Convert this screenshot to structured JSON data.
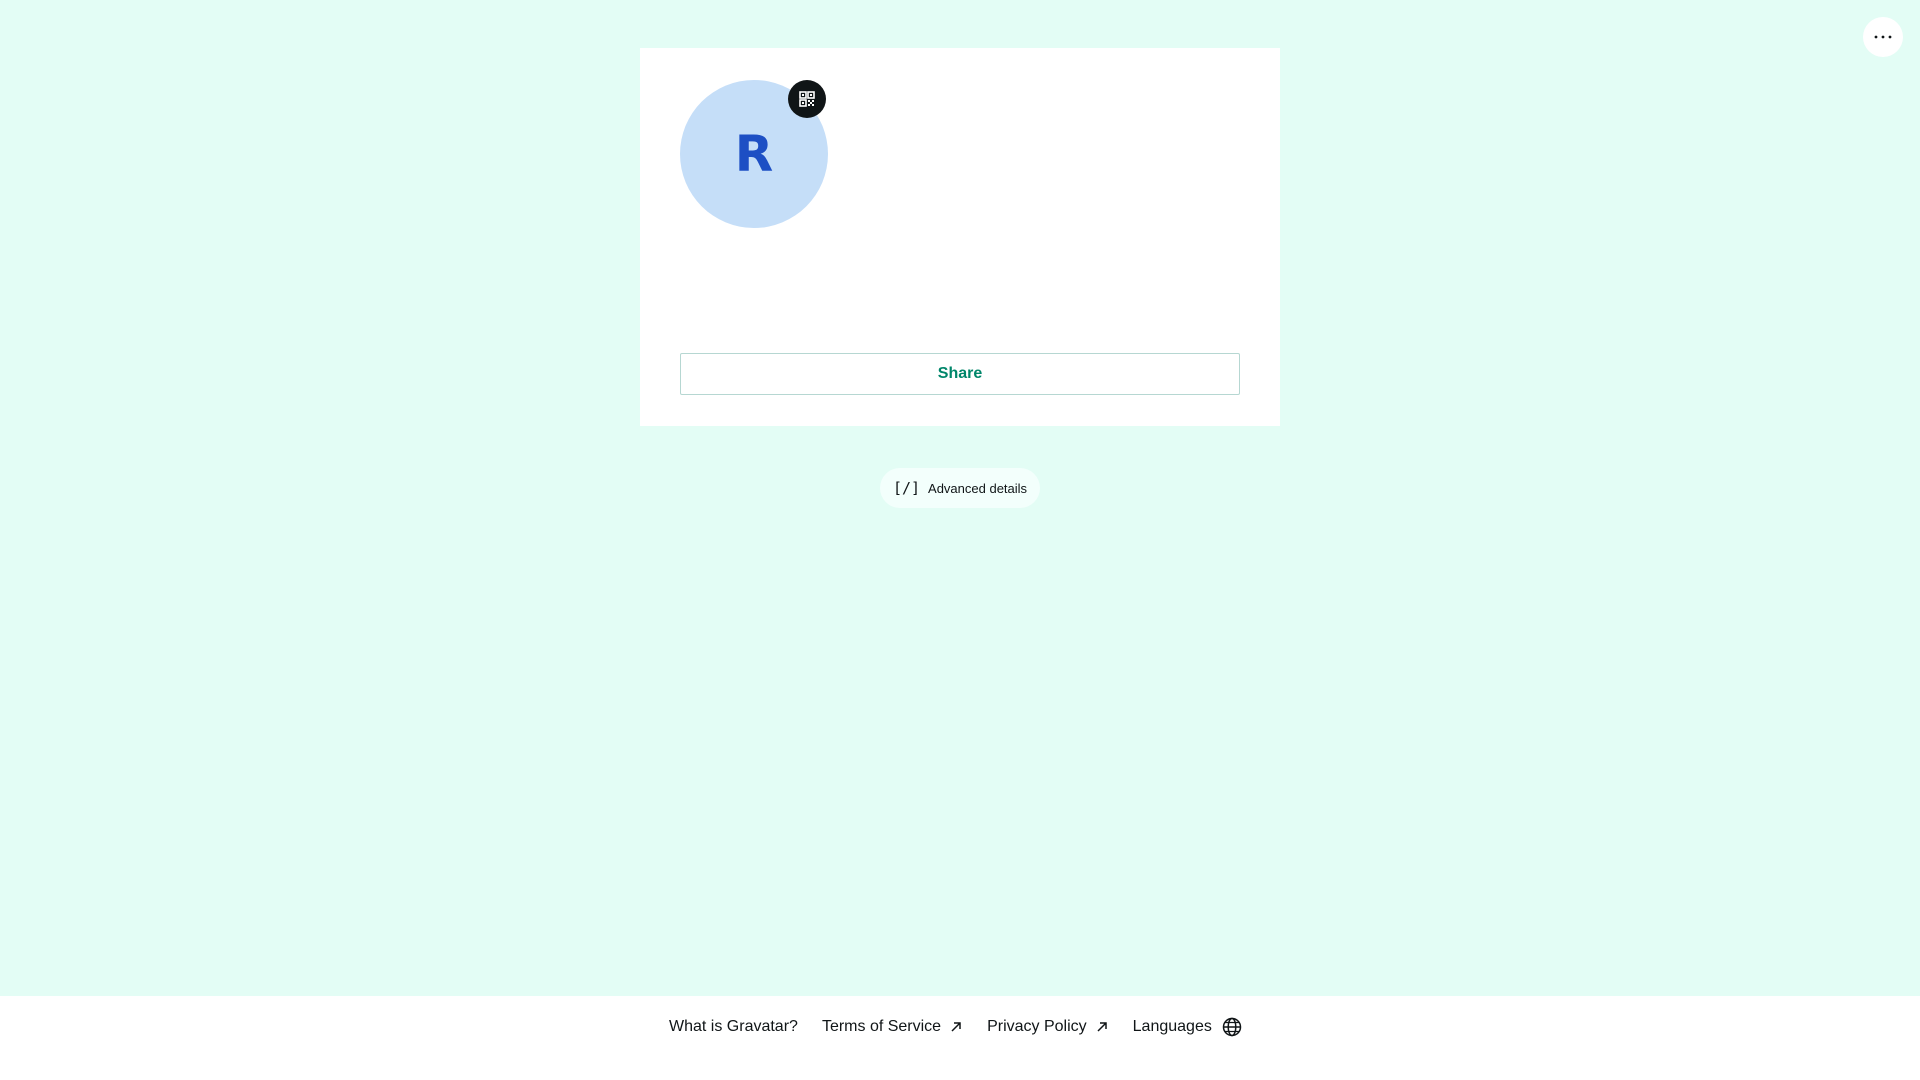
{
  "header": {
    "more_icon": "ellipsis-icon"
  },
  "profile": {
    "avatar_initial": "R",
    "qr_icon": "qr-code-icon",
    "share_label": "Share"
  },
  "advanced": {
    "icon_text": "[/]",
    "label": "Advanced details"
  },
  "footer": {
    "links": [
      {
        "label": "What is Gravatar?"
      },
      {
        "label": "Terms of Service",
        "icon": "external-link-icon"
      },
      {
        "label": "Privacy Policy",
        "icon": "external-link-icon"
      },
      {
        "label": "Languages",
        "icon": "globe-icon"
      }
    ]
  },
  "colors": {
    "background": "#e3fdf5",
    "avatar_bg": "#c5def8",
    "avatar_text": "#1d4fc4",
    "accent": "#00866a"
  }
}
